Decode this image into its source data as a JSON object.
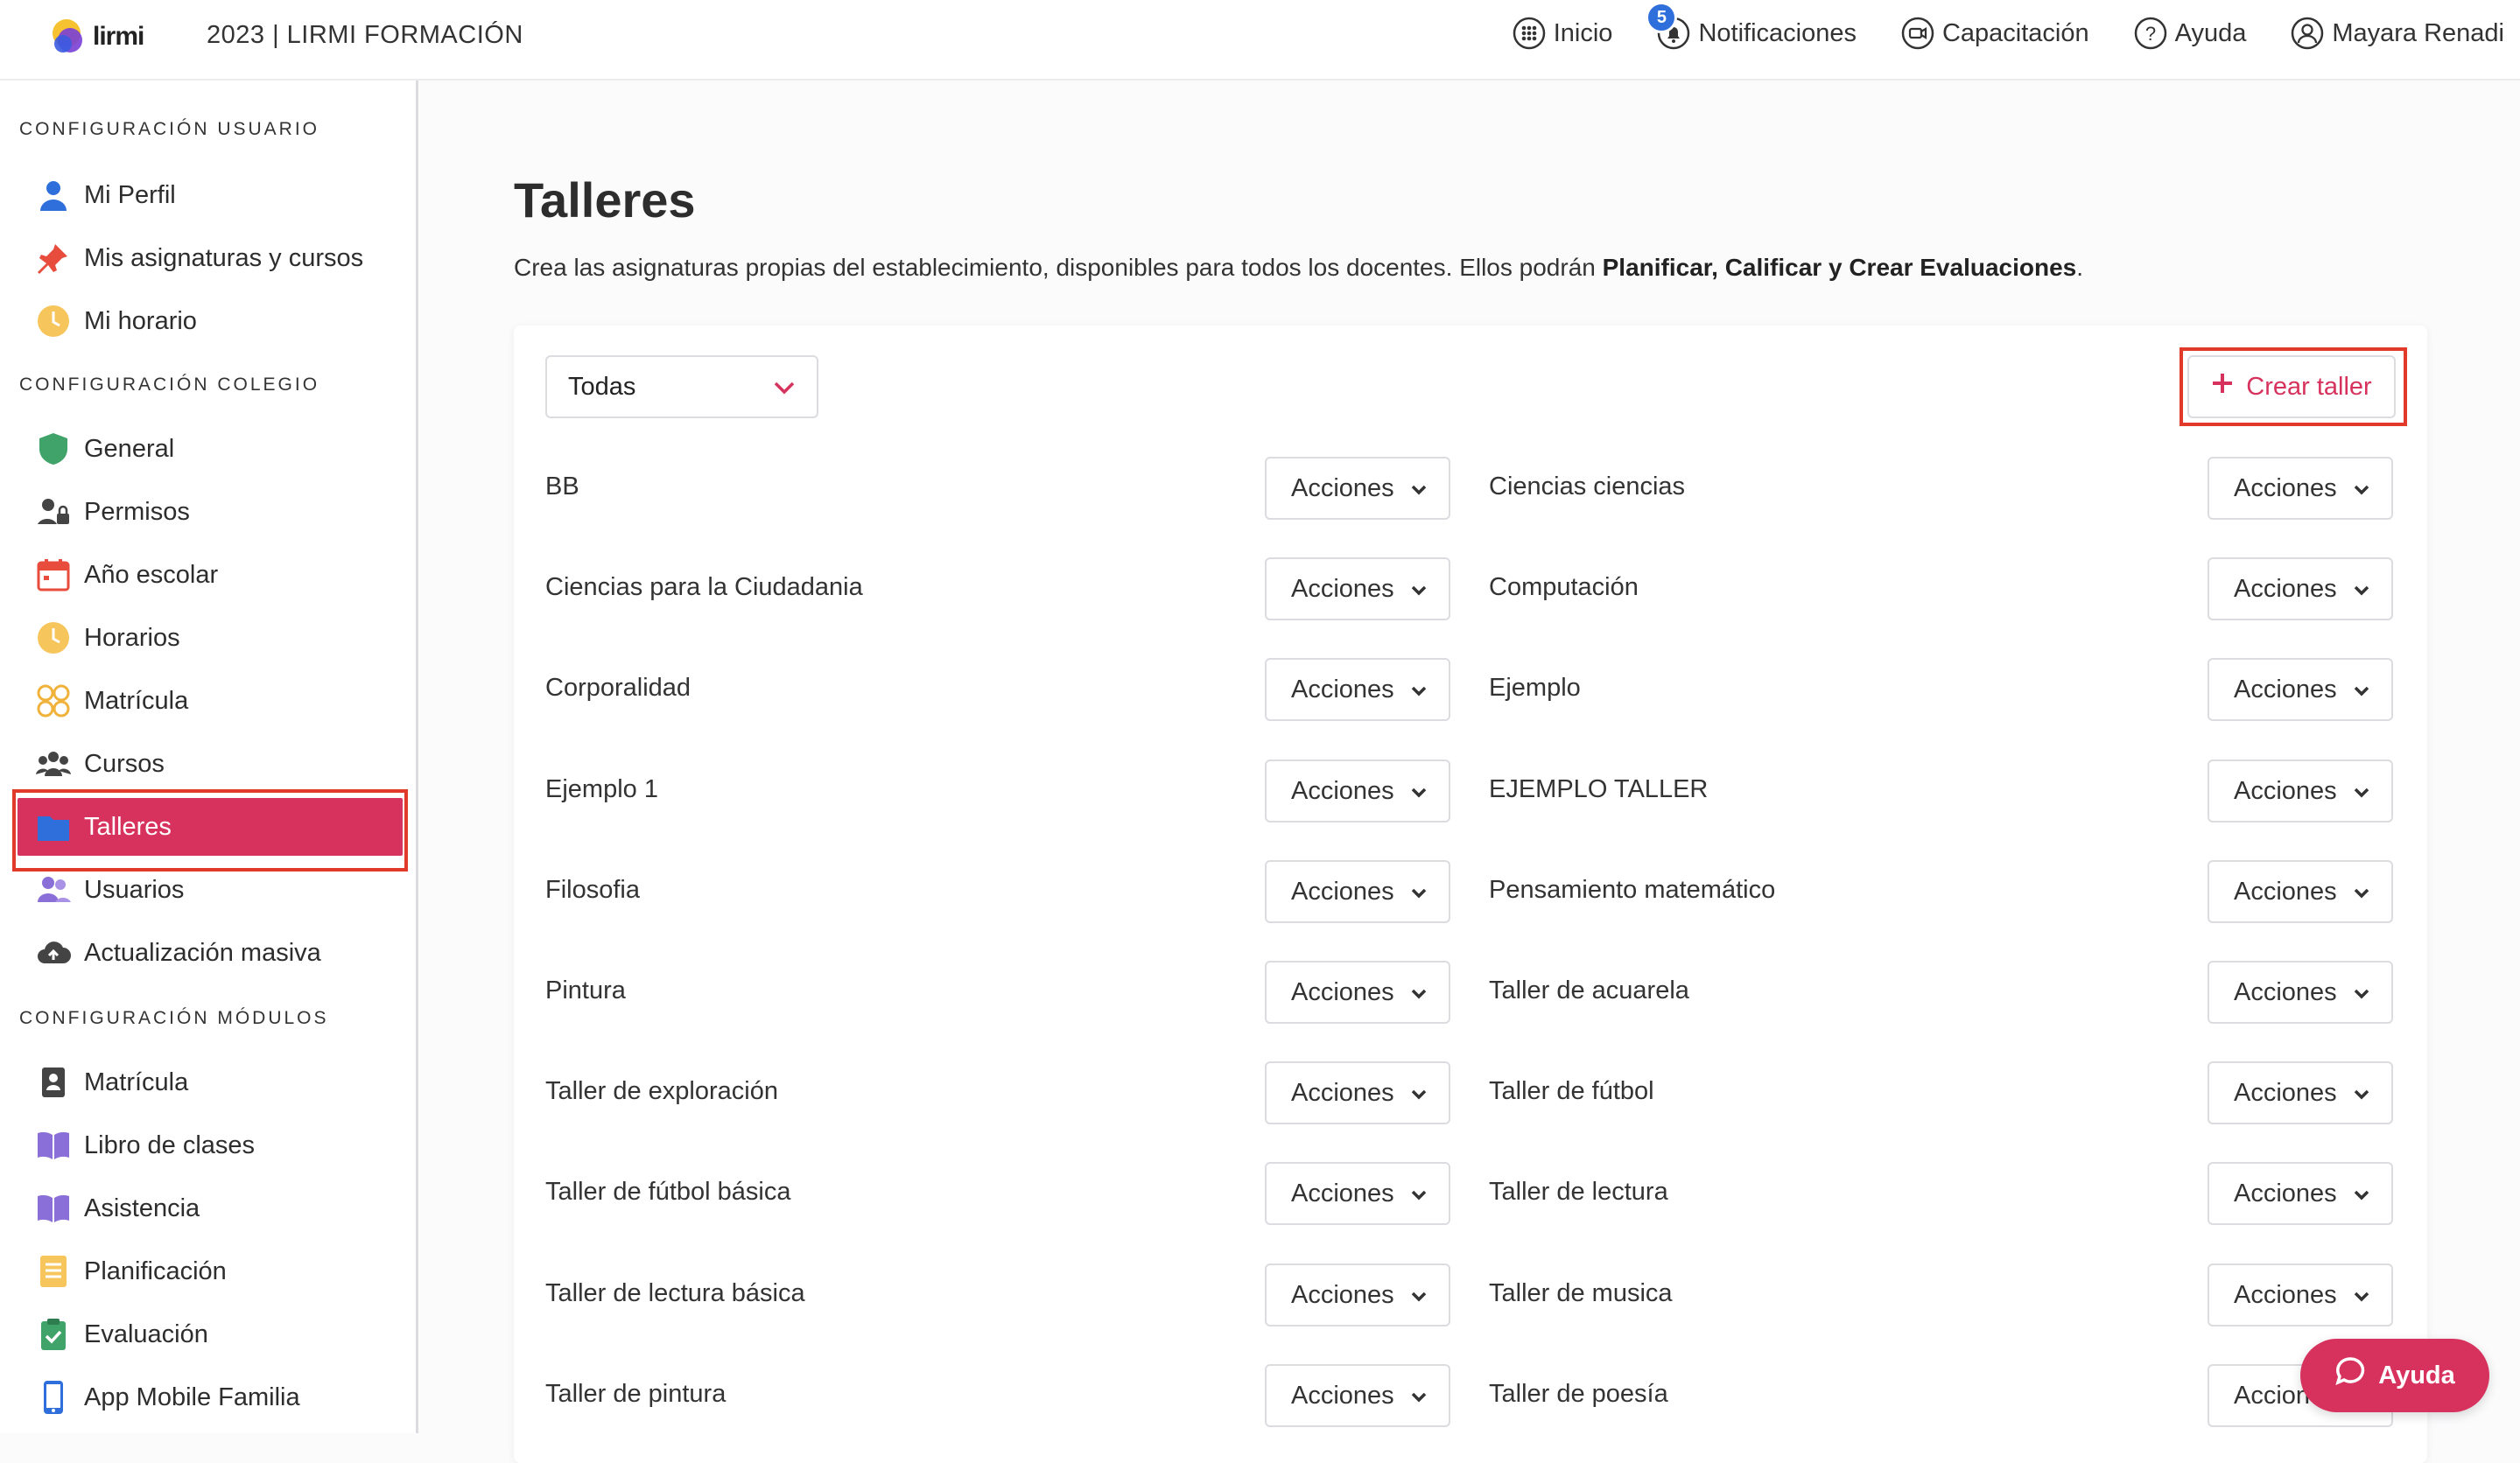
{
  "header": {
    "logo_text": "lirmi",
    "org": "2023  |  LIRMI FORMACIÓN",
    "nav": [
      {
        "label": "Inicio",
        "icon": "grid-icon"
      },
      {
        "label": "Notificaciones",
        "icon": "bell-icon",
        "badge": "5"
      },
      {
        "label": "Capacitación",
        "icon": "video-icon"
      },
      {
        "label": "Ayuda",
        "icon": "question-icon"
      },
      {
        "label": "Mayara Renadi",
        "icon": "user-circle-icon"
      }
    ]
  },
  "sidebar": {
    "sections": [
      {
        "title": "CONFIGURACIÓN USUARIO"
      },
      {
        "title": "CONFIGURACIÓN COLEGIO"
      },
      {
        "title": "CONFIGURACIÓN MÓDULOS"
      }
    ],
    "items": [
      {
        "label": "Mi Perfil",
        "icon": "user-icon"
      },
      {
        "label": "Mis asignaturas y cursos",
        "icon": "pin-icon"
      },
      {
        "label": "Mi horario",
        "icon": "clock-icon"
      },
      {
        "label": "General",
        "icon": "shield-icon"
      },
      {
        "label": "Permisos",
        "icon": "user-lock-icon"
      },
      {
        "label": "Año escolar",
        "icon": "calendar-icon"
      },
      {
        "label": "Horarios",
        "icon": "clock-icon"
      },
      {
        "label": "Matrícula",
        "icon": "faces-icon"
      },
      {
        "label": "Cursos",
        "icon": "users-icon"
      },
      {
        "label": "Talleres",
        "icon": "folder-icon",
        "active": true
      },
      {
        "label": "Usuarios",
        "icon": "users-icon"
      },
      {
        "label": "Actualización masiva",
        "icon": "cloud-upload-icon"
      },
      {
        "label": "Matrícula",
        "icon": "id-card-icon"
      },
      {
        "label": "Libro de clases",
        "icon": "book-icon"
      },
      {
        "label": "Asistencia",
        "icon": "book-icon"
      },
      {
        "label": "Planificación",
        "icon": "document-icon"
      },
      {
        "label": "Evaluación",
        "icon": "clipboard-check-icon"
      },
      {
        "label": "App Mobile Familia",
        "icon": "mobile-icon"
      }
    ]
  },
  "main": {
    "title": "Talleres",
    "description_prefix": "Crea las asignaturas propias del establecimiento, disponibles para todos los docentes. Ellos podrán ",
    "description_bold": "Planificar, Calificar y Crear Evaluaciones",
    "description_suffix": ".",
    "filter_value": "Todas",
    "create_label": "Crear taller",
    "actions_label": "Acciones",
    "workshops": [
      "BB",
      "Ciencias ciencias",
      "Ciencias para la Ciudadania",
      "Computación",
      "Corporalidad",
      "Ejemplo",
      "Ejemplo 1",
      "EJEMPLO TALLER",
      "Filosofia",
      "Pensamiento matemático",
      "Pintura",
      "Taller de acuarela",
      "Taller de exploración",
      "Taller de fútbol",
      "Taller de fútbol básica",
      "Taller de lectura",
      "Taller de lectura básica",
      "Taller de musica",
      "Taller de pintura",
      "Taller de poesía"
    ]
  },
  "help_fab": {
    "label": "Ayuda"
  },
  "colors": {
    "accent": "#d7325d",
    "highlight_frame": "#e23a2a",
    "badge": "#2f6fdc"
  }
}
